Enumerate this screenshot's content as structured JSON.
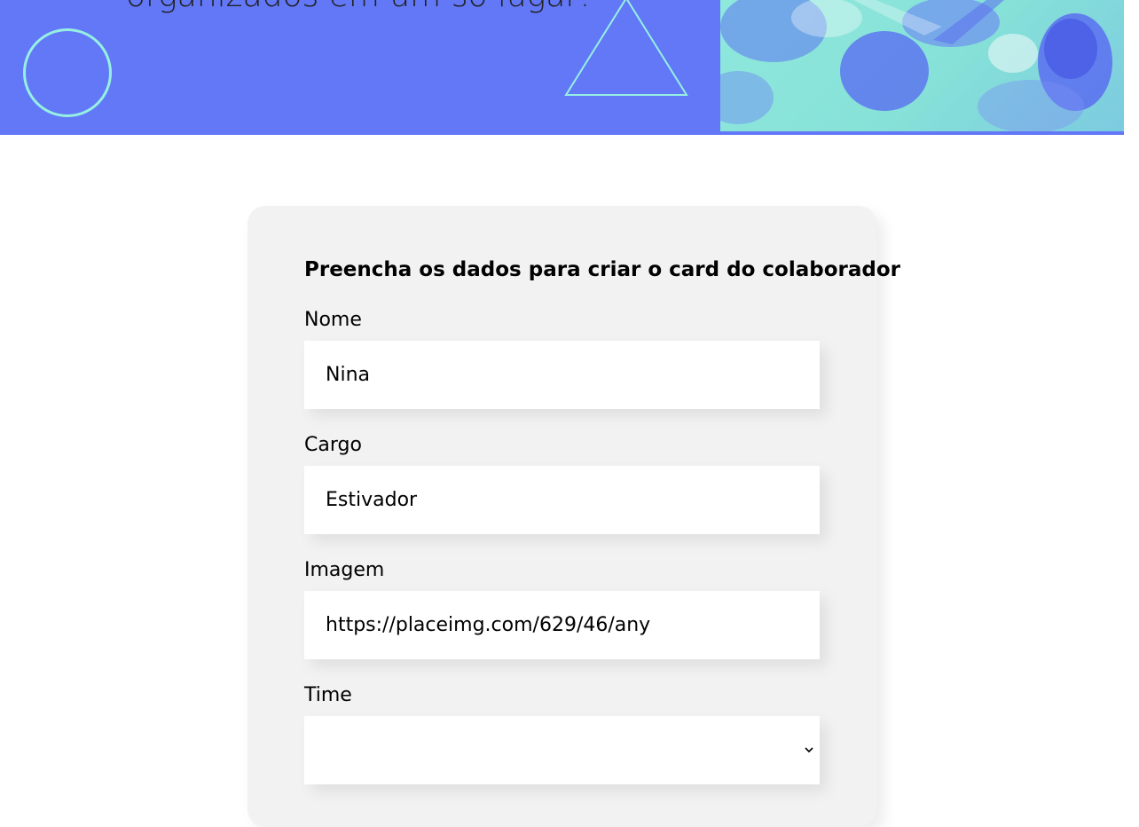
{
  "banner": {
    "title": "organizados em um só lugar!",
    "colors": {
      "background": "#6278f7",
      "accent": "#96f0e2"
    },
    "decor_icons": [
      "circle-outline-icon",
      "triangle-outline-icon"
    ],
    "image": "team-hands-photo"
  },
  "form": {
    "heading": "Preencha os dados para criar o card do colaborador",
    "fields": [
      {
        "label": "Nome",
        "value": "Nina"
      },
      {
        "label": "Cargo",
        "value": "Estivador"
      },
      {
        "label": "Imagem",
        "value": "https://placeimg.com/629/46/any"
      }
    ],
    "time": {
      "label": "Time",
      "selected": "",
      "icon": "chevron-down-icon"
    }
  }
}
